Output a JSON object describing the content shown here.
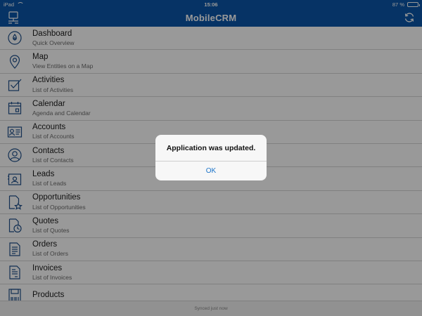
{
  "status_bar": {
    "carrier": "iPad",
    "time": "15:06",
    "battery_text": "87 %",
    "battery_level": 0.87
  },
  "nav": {
    "title": "MobileCRM",
    "left_icon": "device-sync-icon",
    "right_icon": "refresh-icon",
    "bar_color": "#0a56a8"
  },
  "menu": [
    {
      "title": "Dashboard",
      "subtitle": "Quick Overview",
      "icon": "dashboard-icon"
    },
    {
      "title": "Map",
      "subtitle": "View Entities on a Map",
      "icon": "map-pin-icon"
    },
    {
      "title": "Activities",
      "subtitle": "List of Activities",
      "icon": "activities-icon"
    },
    {
      "title": "Calendar",
      "subtitle": "Agenda and Calendar",
      "icon": "calendar-icon"
    },
    {
      "title": "Accounts",
      "subtitle": "List of Accounts",
      "icon": "accounts-icon"
    },
    {
      "title": "Contacts",
      "subtitle": "List of Contacts",
      "icon": "contacts-icon"
    },
    {
      "title": "Leads",
      "subtitle": "List of Leads",
      "icon": "leads-icon"
    },
    {
      "title": "Opportunities",
      "subtitle": "List of Opportunities",
      "icon": "opportunities-icon"
    },
    {
      "title": "Quotes",
      "subtitle": "List of Quotes",
      "icon": "quotes-icon"
    },
    {
      "title": "Orders",
      "subtitle": "List of Orders",
      "icon": "orders-icon"
    },
    {
      "title": "Invoices",
      "subtitle": "List of Invoices",
      "icon": "invoices-icon"
    },
    {
      "title": "Products",
      "subtitle": "",
      "icon": "products-icon"
    }
  ],
  "footer": {
    "sync_status": "Synced just now"
  },
  "alert": {
    "message": "Application was updated.",
    "button_label": "OK",
    "button_color": "#1a73c9"
  }
}
